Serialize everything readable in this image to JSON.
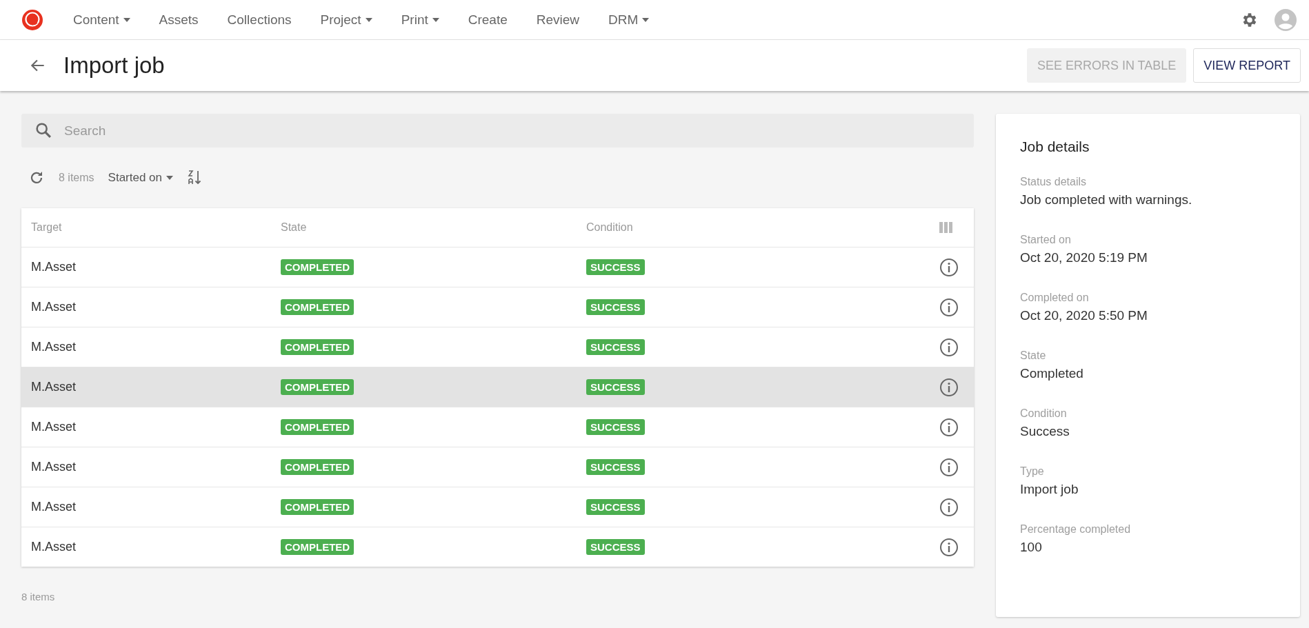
{
  "nav": {
    "items": [
      {
        "label": "Content",
        "dropdown": true
      },
      {
        "label": "Assets",
        "dropdown": false
      },
      {
        "label": "Collections",
        "dropdown": false
      },
      {
        "label": "Project",
        "dropdown": true
      },
      {
        "label": "Print",
        "dropdown": true
      },
      {
        "label": "Create",
        "dropdown": false
      },
      {
        "label": "Review",
        "dropdown": false
      },
      {
        "label": "DRM",
        "dropdown": true
      }
    ]
  },
  "header": {
    "title": "Import job",
    "buttons": [
      {
        "label": "SEE ERRORS IN TABLE",
        "disabled": true
      },
      {
        "label": "VIEW REPORT",
        "disabled": false
      }
    ]
  },
  "search": {
    "placeholder": "Search"
  },
  "toolbar": {
    "count": "8 items",
    "sort": "Started on"
  },
  "table": {
    "columns": [
      "Target",
      "State",
      "Condition"
    ],
    "rows": [
      {
        "target": "M.Asset",
        "state": "COMPLETED",
        "condition": "SUCCESS",
        "hovered": false
      },
      {
        "target": "M.Asset",
        "state": "COMPLETED",
        "condition": "SUCCESS",
        "hovered": false
      },
      {
        "target": "M.Asset",
        "state": "COMPLETED",
        "condition": "SUCCESS",
        "hovered": false
      },
      {
        "target": "M.Asset",
        "state": "COMPLETED",
        "condition": "SUCCESS",
        "hovered": true
      },
      {
        "target": "M.Asset",
        "state": "COMPLETED",
        "condition": "SUCCESS",
        "hovered": false
      },
      {
        "target": "M.Asset",
        "state": "COMPLETED",
        "condition": "SUCCESS",
        "hovered": false
      },
      {
        "target": "M.Asset",
        "state": "COMPLETED",
        "condition": "SUCCESS",
        "hovered": false
      },
      {
        "target": "M.Asset",
        "state": "COMPLETED",
        "condition": "SUCCESS",
        "hovered": false
      }
    ]
  },
  "footer": "8 items",
  "details": {
    "title": "Job details",
    "fields": [
      {
        "label": "Status details",
        "value": "Job completed with warnings."
      },
      {
        "label": "Started on",
        "value": "Oct 20, 2020 5:19 PM"
      },
      {
        "label": "Completed on",
        "value": "Oct 20, 2020 5:50 PM"
      },
      {
        "label": "State",
        "value": "Completed"
      },
      {
        "label": "Condition",
        "value": "Success"
      },
      {
        "label": "Type",
        "value": "Import job"
      },
      {
        "label": "Percentage completed",
        "value": "100"
      }
    ]
  }
}
